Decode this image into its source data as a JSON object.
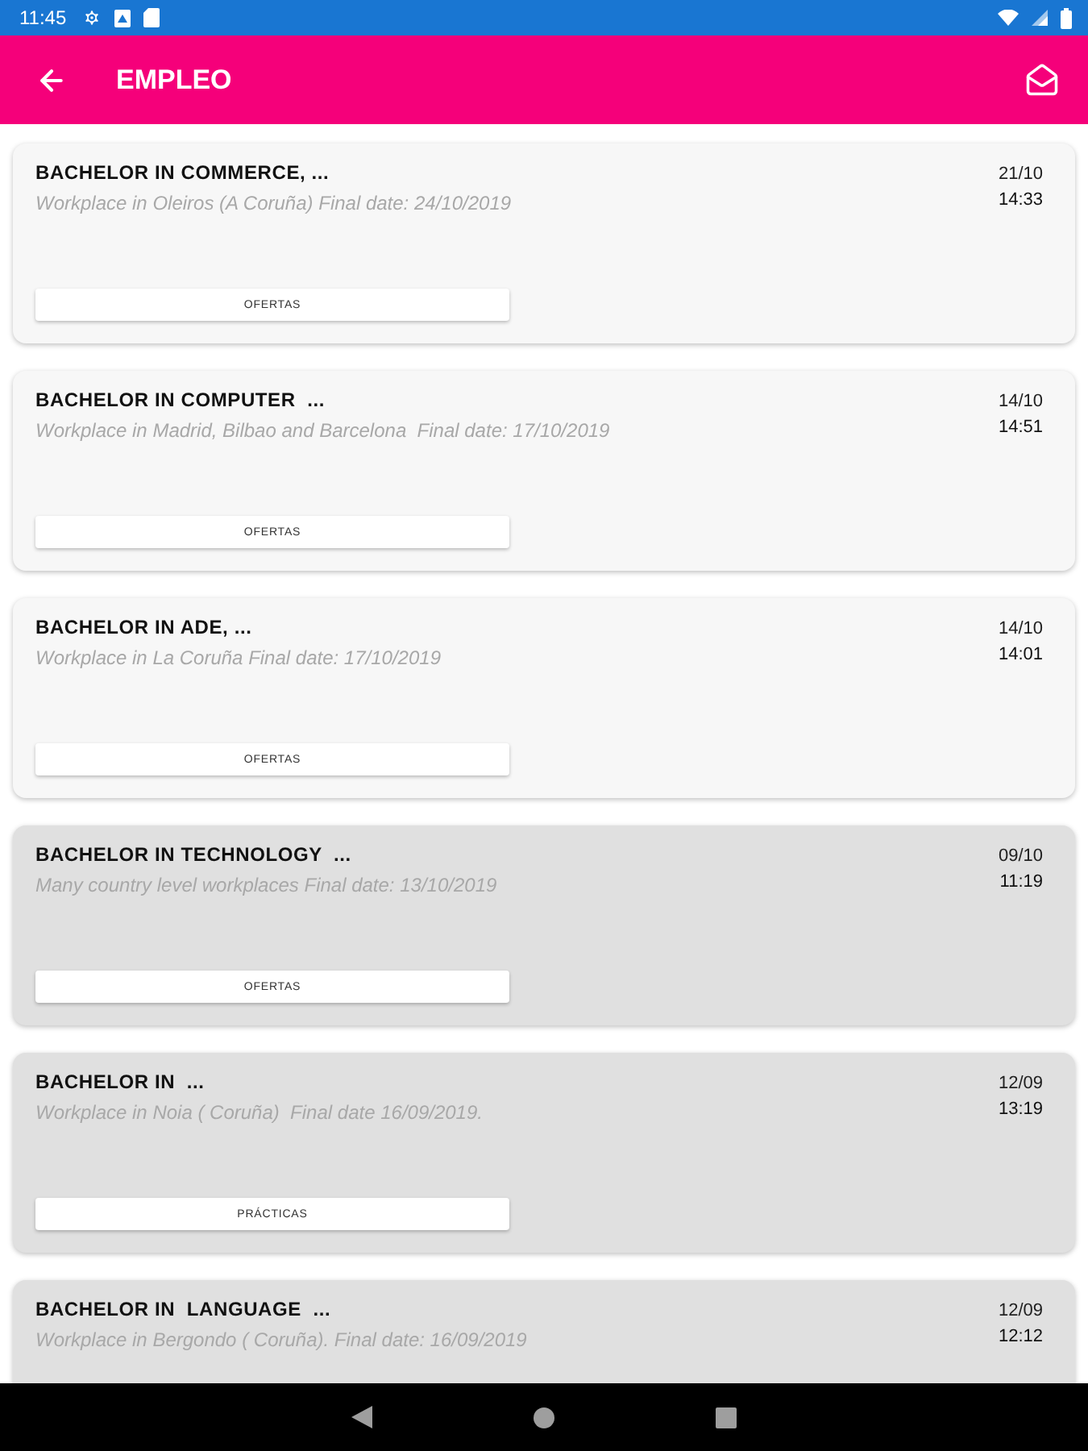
{
  "status_bar": {
    "time": "11:45"
  },
  "app_bar": {
    "title": "EMPLEO"
  },
  "offers": [
    {
      "title": "BACHELOR IN COMMERCE, ...",
      "description": "Workplace in Oleiros (A Coruña) Final date: 24/10/2019",
      "date": "21/10",
      "time": "14:33",
      "button": "OFERTAS",
      "read": false
    },
    {
      "title": "BACHELOR IN COMPUTER  ...",
      "description": "Workplace in Madrid, Bilbao and Barcelona  Final date: 17/10/2019",
      "date": "14/10",
      "time": "14:51",
      "button": "OFERTAS",
      "read": false
    },
    {
      "title": "BACHELOR IN ADE, ...",
      "description": "Workplace in La Coruña Final date: 17/10/2019",
      "date": "14/10",
      "time": "14:01",
      "button": "OFERTAS",
      "read": false
    },
    {
      "title": "BACHELOR IN TECHNOLOGY  ...",
      "description": "Many country level workplaces Final date: 13/10/2019",
      "date": "09/10",
      "time": "11:19",
      "button": "OFERTAS",
      "read": true
    },
    {
      "title": "BACHELOR IN  ...",
      "description": "Workplace in Noia ( Coruña)  Final date 16/09/2019.",
      "date": "12/09",
      "time": "13:19",
      "button": "PRÁCTICAS",
      "read": true
    },
    {
      "title": "BACHELOR IN  LANGUAGE  ...",
      "description": "Workplace in Bergondo ( Coruña). Final date: 16/09/2019",
      "date": "12/09",
      "time": "12:12",
      "read": true
    }
  ]
}
